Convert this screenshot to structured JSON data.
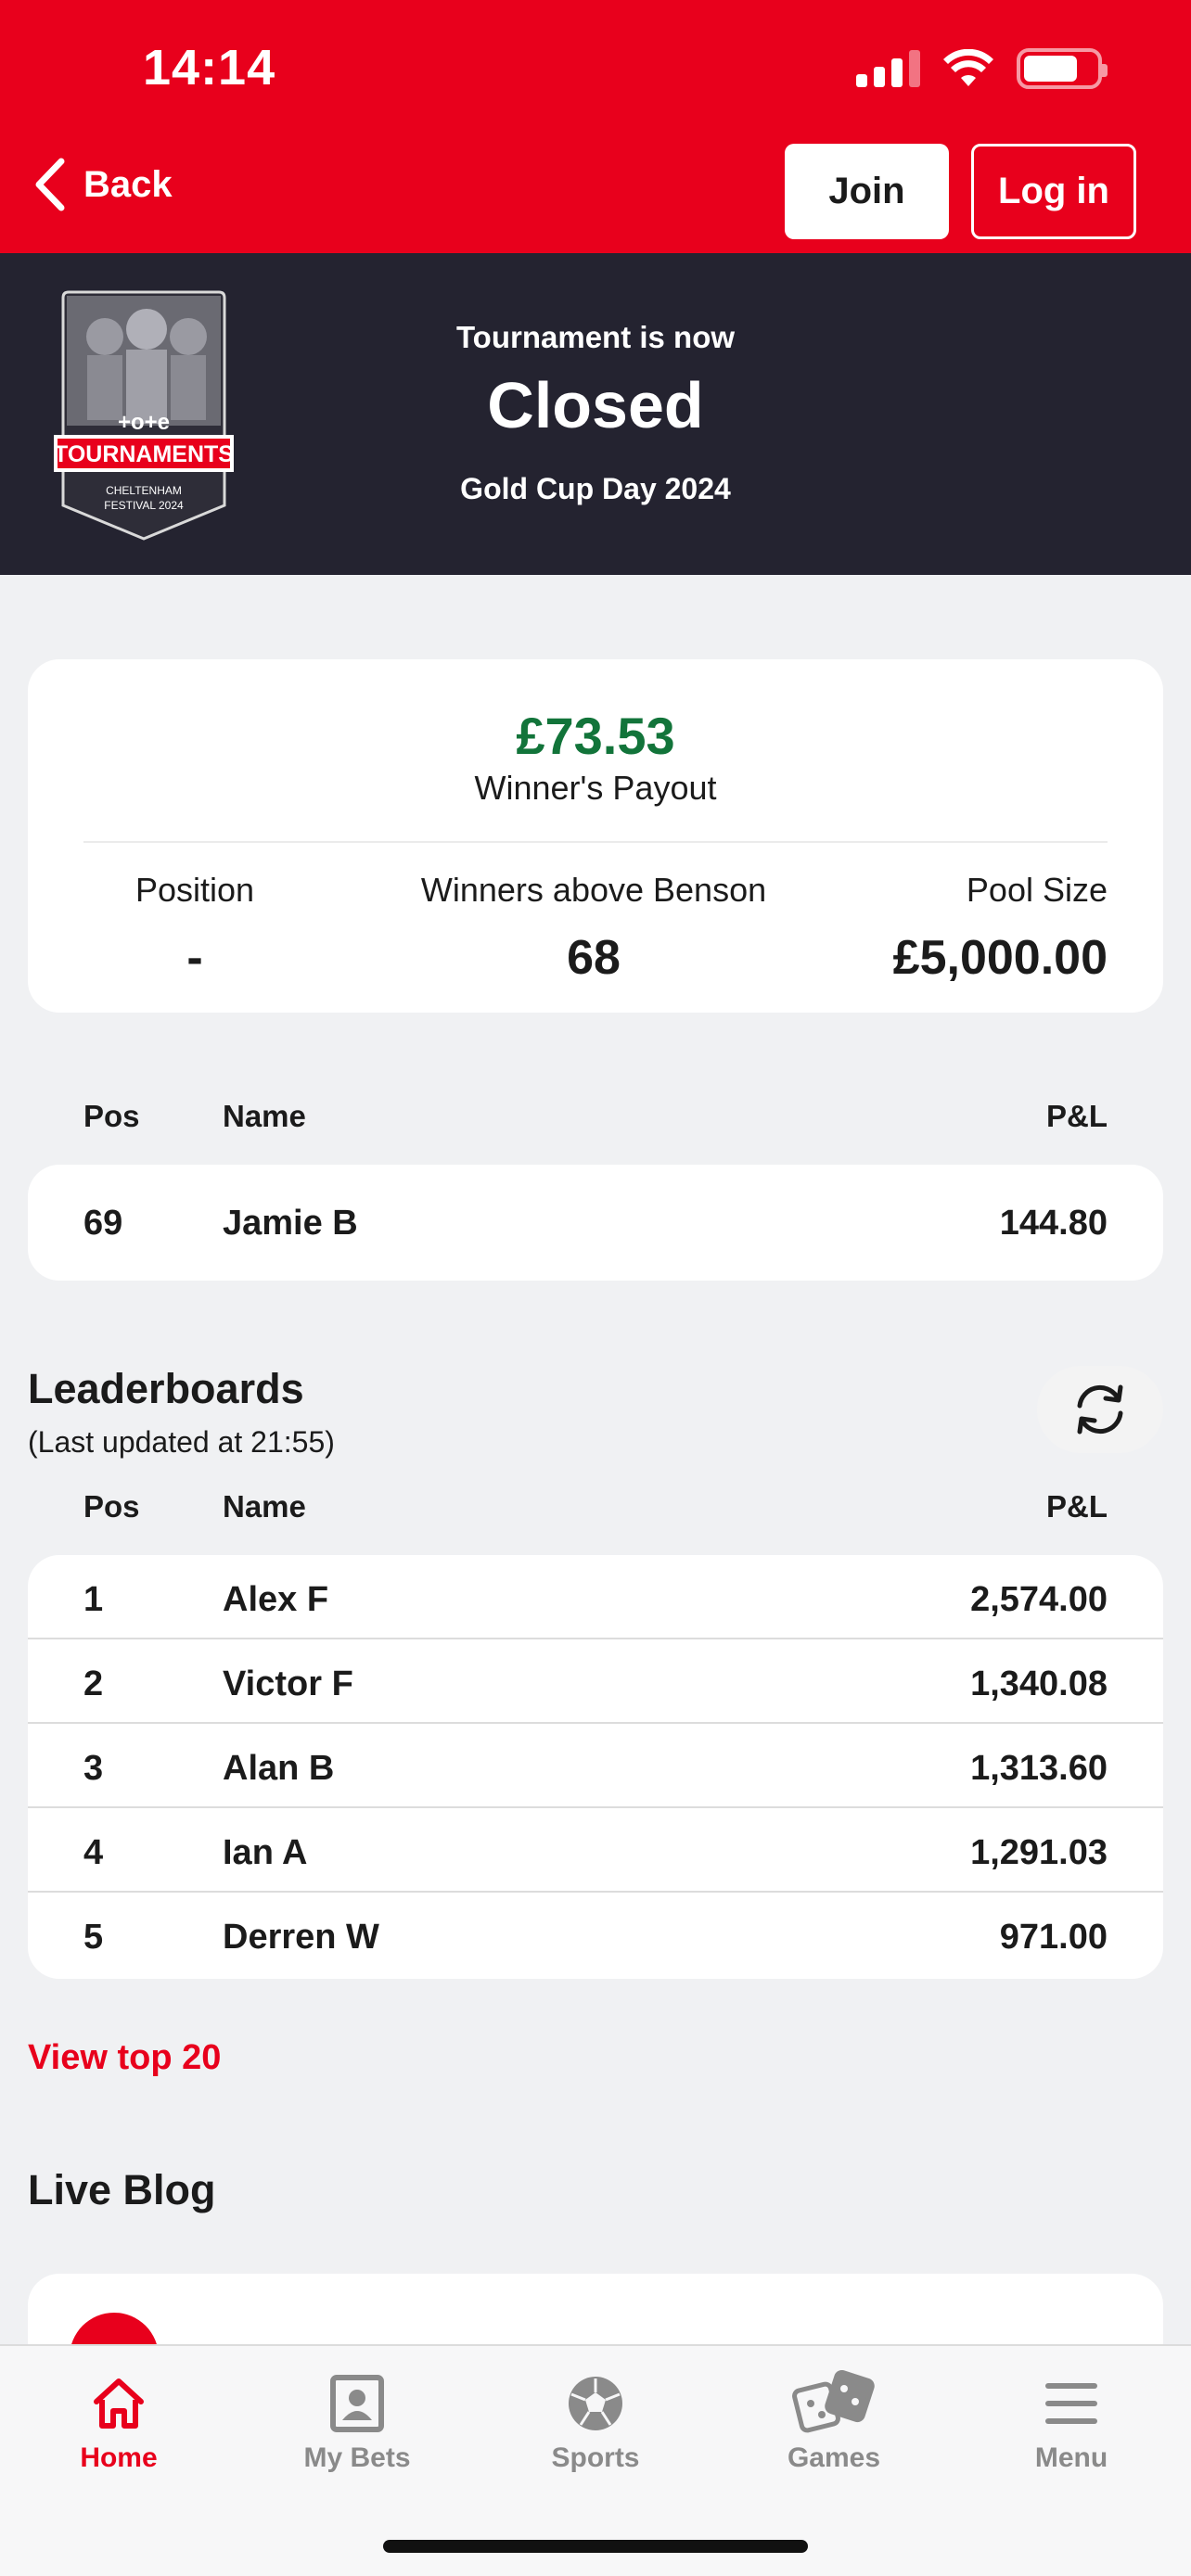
{
  "status_bar": {
    "time": "14:14"
  },
  "header": {
    "back_label": "Back",
    "join_label": "Join",
    "login_label": "Log in"
  },
  "banner": {
    "line1": "Tournament is now",
    "status": "Closed",
    "event": "Gold Cup Day 2024",
    "badge": {
      "brand": "+o+e",
      "title": "TOURNAMENTS",
      "sub1": "CHELTENHAM",
      "sub2": "FESTIVAL 2024"
    }
  },
  "payout": {
    "amount": "£73.53",
    "label": "Winner's Payout",
    "position_label": "Position",
    "position_value": "-",
    "winners_label": "Winners above Benson",
    "winners_value": "68",
    "pool_label": "Pool Size",
    "pool_value": "£5,000.00"
  },
  "table_headers": {
    "pos": "Pos",
    "name": "Name",
    "pl": "P&L"
  },
  "user_row": {
    "pos": "69",
    "name": "Jamie B",
    "pl": "144.80"
  },
  "leaderboards": {
    "title": "Leaderboards",
    "updated": "(Last updated at 21:55)",
    "rows": [
      {
        "pos": "1",
        "name": "Alex F",
        "pl": "2,574.00"
      },
      {
        "pos": "2",
        "name": "Victor F",
        "pl": "1,340.08"
      },
      {
        "pos": "3",
        "name": "Alan B",
        "pl": "1,313.60"
      },
      {
        "pos": "4",
        "name": "Ian A",
        "pl": "1,291.03"
      },
      {
        "pos": "5",
        "name": "Derren W",
        "pl": "971.00"
      }
    ],
    "view_top_label": "View top 20"
  },
  "live_blog": {
    "title": "Live Blog"
  },
  "tabbar": {
    "items": [
      {
        "label": "Home",
        "icon": "home-icon",
        "active": true
      },
      {
        "label": "My Bets",
        "icon": "my-bets-icon",
        "active": false
      },
      {
        "label": "Sports",
        "icon": "football-icon",
        "active": false
      },
      {
        "label": "Games",
        "icon": "dice-icon",
        "active": false
      },
      {
        "label": "Menu",
        "icon": "hamburger-icon",
        "active": false
      }
    ]
  },
  "colors": {
    "brand_red": "#e8001c",
    "banner_dark": "#242330",
    "payout_green": "#12743a"
  }
}
